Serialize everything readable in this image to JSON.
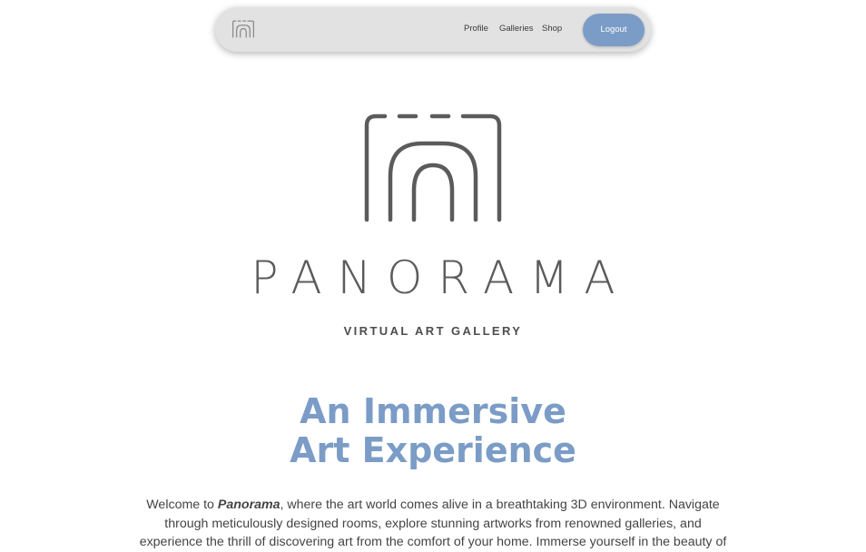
{
  "nav": {
    "logo": "panorama-logo-icon",
    "links": [
      {
        "label": "Profile"
      },
      {
        "label": "Galleries"
      },
      {
        "label": "Shop"
      }
    ],
    "logout_label": "Logout"
  },
  "hero": {
    "logo_icon": "panorama-arch-logo-icon",
    "brand": "PANORAMA",
    "tagline": "VIRTUAL ART GALLERY",
    "headline_line1": "An Immersive",
    "headline_line2": "Art Experience",
    "intro_prefix": "Welcome to ",
    "intro_brand": "Panorama",
    "intro_text": ", where the art world comes alive in a breathtaking 3D environment. Navigate through meticulously designed rooms, explore stunning artworks from renowned galleries, and experience the thrill of discovering art from the comfort of your home. Immerse yourself in the beauty of creativity, interact with"
  },
  "colors": {
    "accent": "#7b9cc6",
    "navbar_bg": "#e2e2e2",
    "logo_gray": "#5b5b5b",
    "text": "#444444"
  }
}
